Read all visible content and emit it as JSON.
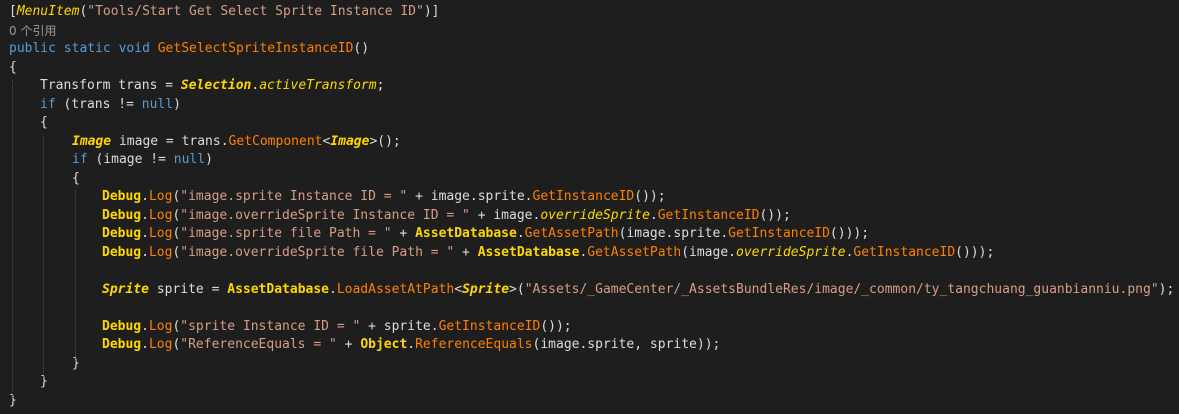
{
  "editor": {
    "attribute_open": "[",
    "attribute_name": "MenuItem",
    "attribute_args_open": "(",
    "attribute_string": "\"Tools/Start Get Select Sprite Instance ID\"",
    "attribute_close": ")]",
    "codelens": "0 个引用",
    "sig_public": "public",
    "sig_static": "static",
    "sig_void": "void",
    "sig_name": "GetSelectSpriteInstanceID",
    "sig_parens": "()",
    "brace_open": "{",
    "brace_close": "}",
    "l4_type": "Transform",
    "l4_rest": " trans = ",
    "l4_cls": "Selection",
    "l4_dot": ".",
    "l4_prop": "activeTransform",
    "l4_end": ";",
    "l5_if": "if",
    "l5_a": " (trans != ",
    "l5_null": "null",
    "l5_b": ")",
    "l7_type": "Image",
    "l7_a": " image = trans.",
    "l7_meth": "GetComponent",
    "l7_lt": "<",
    "l7_gen": "Image",
    "l7_b": ">();",
    "l8_if": "if",
    "l8_a": " (image != ",
    "l8_null": "null",
    "l8_b": ")",
    "debug": "Debug",
    "dot": ".",
    "log": "Log",
    "l10_open": "(",
    "l10_str": "\"image.sprite Instance ID = \"",
    "l10_a": " + image.sprite.",
    "l10_meth": "GetInstanceID",
    "l10_b": "());",
    "l11_open": "(",
    "l11_str": "\"image.overrideSprite Instance ID = \"",
    "l11_a": " + image.",
    "l11_prop": "overrideSprite",
    "l11_dot": ".",
    "l11_meth": "GetInstanceID",
    "l11_b": "());",
    "l12_open": "(",
    "l12_str": "\"image.sprite file Path = \"",
    "l12_a": " + ",
    "l12_cls": "AssetDatabase",
    "l12_dot": ".",
    "l12_meth": "GetAssetPath",
    "l12_b": "(image.sprite.",
    "l12_meth2": "GetInstanceID",
    "l12_c": "()));",
    "l13_open": "(",
    "l13_str": "\"image.overrideSprite file Path = \"",
    "l13_a": " + ",
    "l13_cls": "AssetDatabase",
    "l13_dot": ".",
    "l13_meth": "GetAssetPath",
    "l13_b": "(image.",
    "l13_prop": "overrideSprite",
    "l13_dot2": ".",
    "l13_meth2": "GetInstanceID",
    "l13_c": "()));",
    "l15_type": "Sprite",
    "l15_a": " sprite = ",
    "l15_cls": "AssetDatabase",
    "l15_dot": ".",
    "l15_meth": "LoadAssetAtPath",
    "l15_lt": "<",
    "l15_gen": "Sprite",
    "l15_b": ">(",
    "l15_str": "\"Assets/_GameCenter/_AssetsBundleRes/image/_common/ty_tangchuang_guanbianniu.png\"",
    "l15_c": ");",
    "l17_open": "(",
    "l17_str": "\"sprite Instance ID = \"",
    "l17_a": " + sprite.",
    "l17_meth": "GetInstanceID",
    "l17_b": "());",
    "l18_open": "(",
    "l18_str": "\"ReferenceEquals = \"",
    "l18_a": " + ",
    "l18_cls": "Object",
    "l18_dot": ".",
    "l18_meth": "ReferenceEquals",
    "l18_b": "(image.sprite, sprite));"
  },
  "colors": {
    "background": "#1e1e1e",
    "keyword": "#569cd6",
    "string": "#d69d85",
    "class": "#ffd700",
    "method": "#ff8000",
    "default_text": "#dcdcdc",
    "codelens": "#999999"
  }
}
